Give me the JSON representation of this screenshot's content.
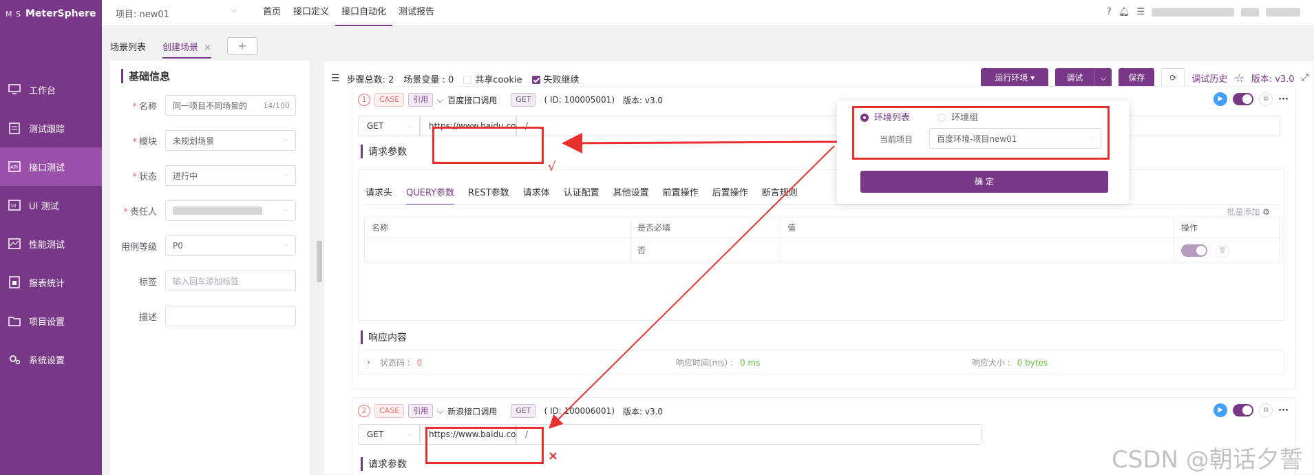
{
  "app": {
    "logo_mark": "M S",
    "name": "MeterSphere"
  },
  "sidebar": {
    "items": [
      {
        "label": "工作台",
        "icon": "monitor-icon"
      },
      {
        "label": "测试跟踪",
        "icon": "clipboard-icon"
      },
      {
        "label": "接口测试",
        "icon": "api-icon"
      },
      {
        "label": "UI 测试",
        "icon": "ui-icon"
      },
      {
        "label": "性能测试",
        "icon": "chart-icon"
      },
      {
        "label": "报表统计",
        "icon": "report-icon"
      },
      {
        "label": "项目设置",
        "icon": "folder-icon"
      },
      {
        "label": "系统设置",
        "icon": "gear-icon"
      }
    ],
    "active_index": 2
  },
  "topbar": {
    "project": "项目: new01",
    "menu": [
      "首页",
      "接口定义",
      "接口自动化",
      "测试报告"
    ],
    "active_menu": 2
  },
  "tabs": {
    "list": "场景列表",
    "current": "创建场景",
    "close": "×",
    "add": "+"
  },
  "form": {
    "section_title": "基础信息",
    "name_label": "名称",
    "name_value": "同一项目不同场景的",
    "name_count": "14/100",
    "module_label": "模块",
    "module_value": "未规划场景",
    "status_label": "状态",
    "status_value": "进行中",
    "owner_label": "责任人",
    "level_label": "用例等级",
    "level_value": "P0",
    "tag_label": "标签",
    "tag_placeholder": "输入回车添加标签",
    "desc_label": "描述"
  },
  "toolbar": {
    "steps_label": "步骤总数:",
    "steps_count": "2",
    "vars_label": "场景变量",
    "vars_value": ": 0",
    "share_cookie": "共享cookie",
    "fail_continue": "失败继续",
    "run_env": "运行环境",
    "debug": "调试",
    "save": "保存",
    "history": "调试历史",
    "version": "版本: v3.0"
  },
  "steps": [
    {
      "index": "1",
      "case": "CASE",
      "ref": "引用",
      "title": "百度接口调用",
      "method_tag": "GET",
      "id_text": "( ID: 100005001)",
      "version": "版本: v3.0",
      "method": "GET",
      "url": "https://www.baidu.co",
      "path": "/",
      "mark": "√"
    },
    {
      "index": "2",
      "case": "CASE",
      "ref": "引用",
      "title": "新浪接口调用",
      "method_tag": "GET",
      "id_text": "( ID: 100006001)",
      "version": "版本: v3.0",
      "method": "GET",
      "url": "https://www.baidu.co",
      "path": "/",
      "mark": "×"
    }
  ],
  "request": {
    "title": "请求参数",
    "tabs": [
      "请求头",
      "QUERY参数",
      "REST参数",
      "请求体",
      "认证配置",
      "其他设置",
      "前置操作",
      "后置操作",
      "断言规则"
    ],
    "active_tab": 1,
    "batch_add": "批量添加",
    "columns": [
      "名称",
      "是否必填",
      "值",
      "操作"
    ],
    "row": {
      "required": "否"
    }
  },
  "response": {
    "title": "响应内容",
    "status_label": "状态码 :",
    "status_value": "0",
    "time_label": "响应时间(ms) :",
    "time_value": "0 ms",
    "size_label": "响应大小 :",
    "size_value": "0 bytes"
  },
  "env_popup": {
    "env_list": "环境列表",
    "env_group": "环境组",
    "current_project_label": "当前项目",
    "current_project_value": "百度环境-项目new01",
    "confirm": "确 定"
  },
  "watermark": "CSDN @朝话夕誓",
  "colors": {
    "brand": "#783887",
    "annotation": "#e8312f"
  }
}
